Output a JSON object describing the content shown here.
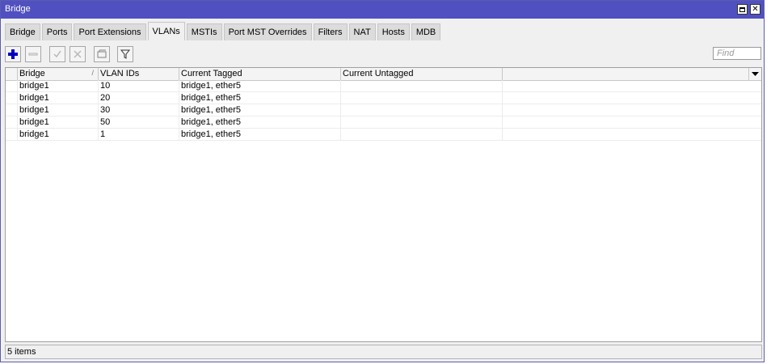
{
  "window": {
    "title": "Bridge"
  },
  "tabs": [
    {
      "label": "Bridge"
    },
    {
      "label": "Ports"
    },
    {
      "label": "Port Extensions"
    },
    {
      "label": "VLANs"
    },
    {
      "label": "MSTIs"
    },
    {
      "label": "Port MST Overrides"
    },
    {
      "label": "Filters"
    },
    {
      "label": "NAT"
    },
    {
      "label": "Hosts"
    },
    {
      "label": "MDB"
    }
  ],
  "active_tab": "VLANs",
  "toolbar": {
    "find_placeholder": "Find",
    "icons": [
      "add-icon",
      "remove-icon",
      "enable-icon",
      "disable-icon",
      "comment-icon",
      "filter-icon"
    ],
    "accent": "#0000c0"
  },
  "table": {
    "columns": [
      "Bridge",
      "VLAN IDs",
      "Current Tagged",
      "Current Untagged"
    ],
    "sort_column": "Bridge",
    "rows": [
      {
        "bridge": "bridge1",
        "vlan_ids": "10",
        "tagged": "bridge1, ether5",
        "untagged": ""
      },
      {
        "bridge": "bridge1",
        "vlan_ids": "20",
        "tagged": "bridge1, ether5",
        "untagged": ""
      },
      {
        "bridge": "bridge1",
        "vlan_ids": "30",
        "tagged": "bridge1, ether5",
        "untagged": ""
      },
      {
        "bridge": "bridge1",
        "vlan_ids": "50",
        "tagged": "bridge1, ether5",
        "untagged": ""
      },
      {
        "bridge": "bridge1",
        "vlan_ids": "1",
        "tagged": "bridge1, ether5",
        "untagged": ""
      }
    ]
  },
  "status": {
    "text": "5 items"
  },
  "colors": {
    "titlebar": "#5050c0",
    "window_bg": "#f0f0f0"
  }
}
